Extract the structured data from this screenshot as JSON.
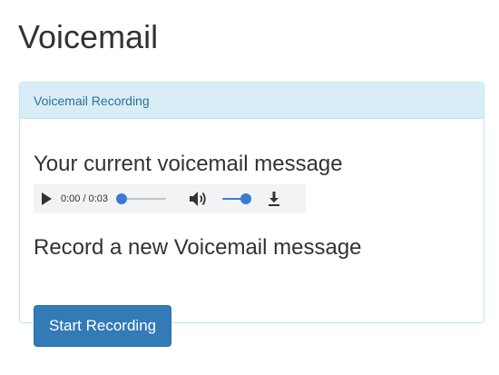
{
  "page": {
    "title": "Voicemail"
  },
  "panel": {
    "heading": "Voicemail Recording",
    "current_heading": "Your current voicemail message",
    "player": {
      "time": "0:00 / 0:03",
      "progress_fraction": 0.0,
      "volume_fraction": 1.0,
      "icons": [
        "play-icon",
        "volume-icon",
        "download-icon"
      ]
    },
    "record_heading": "Record a new Voicemail message",
    "record_button": "Start Recording"
  },
  "colors": {
    "panel_heading_bg": "#d9edf7",
    "panel_heading_text": "#31708f",
    "panel_border": "#bce8f1",
    "primary_button": "#337ab7",
    "slider_accent": "#3a7bd5"
  }
}
